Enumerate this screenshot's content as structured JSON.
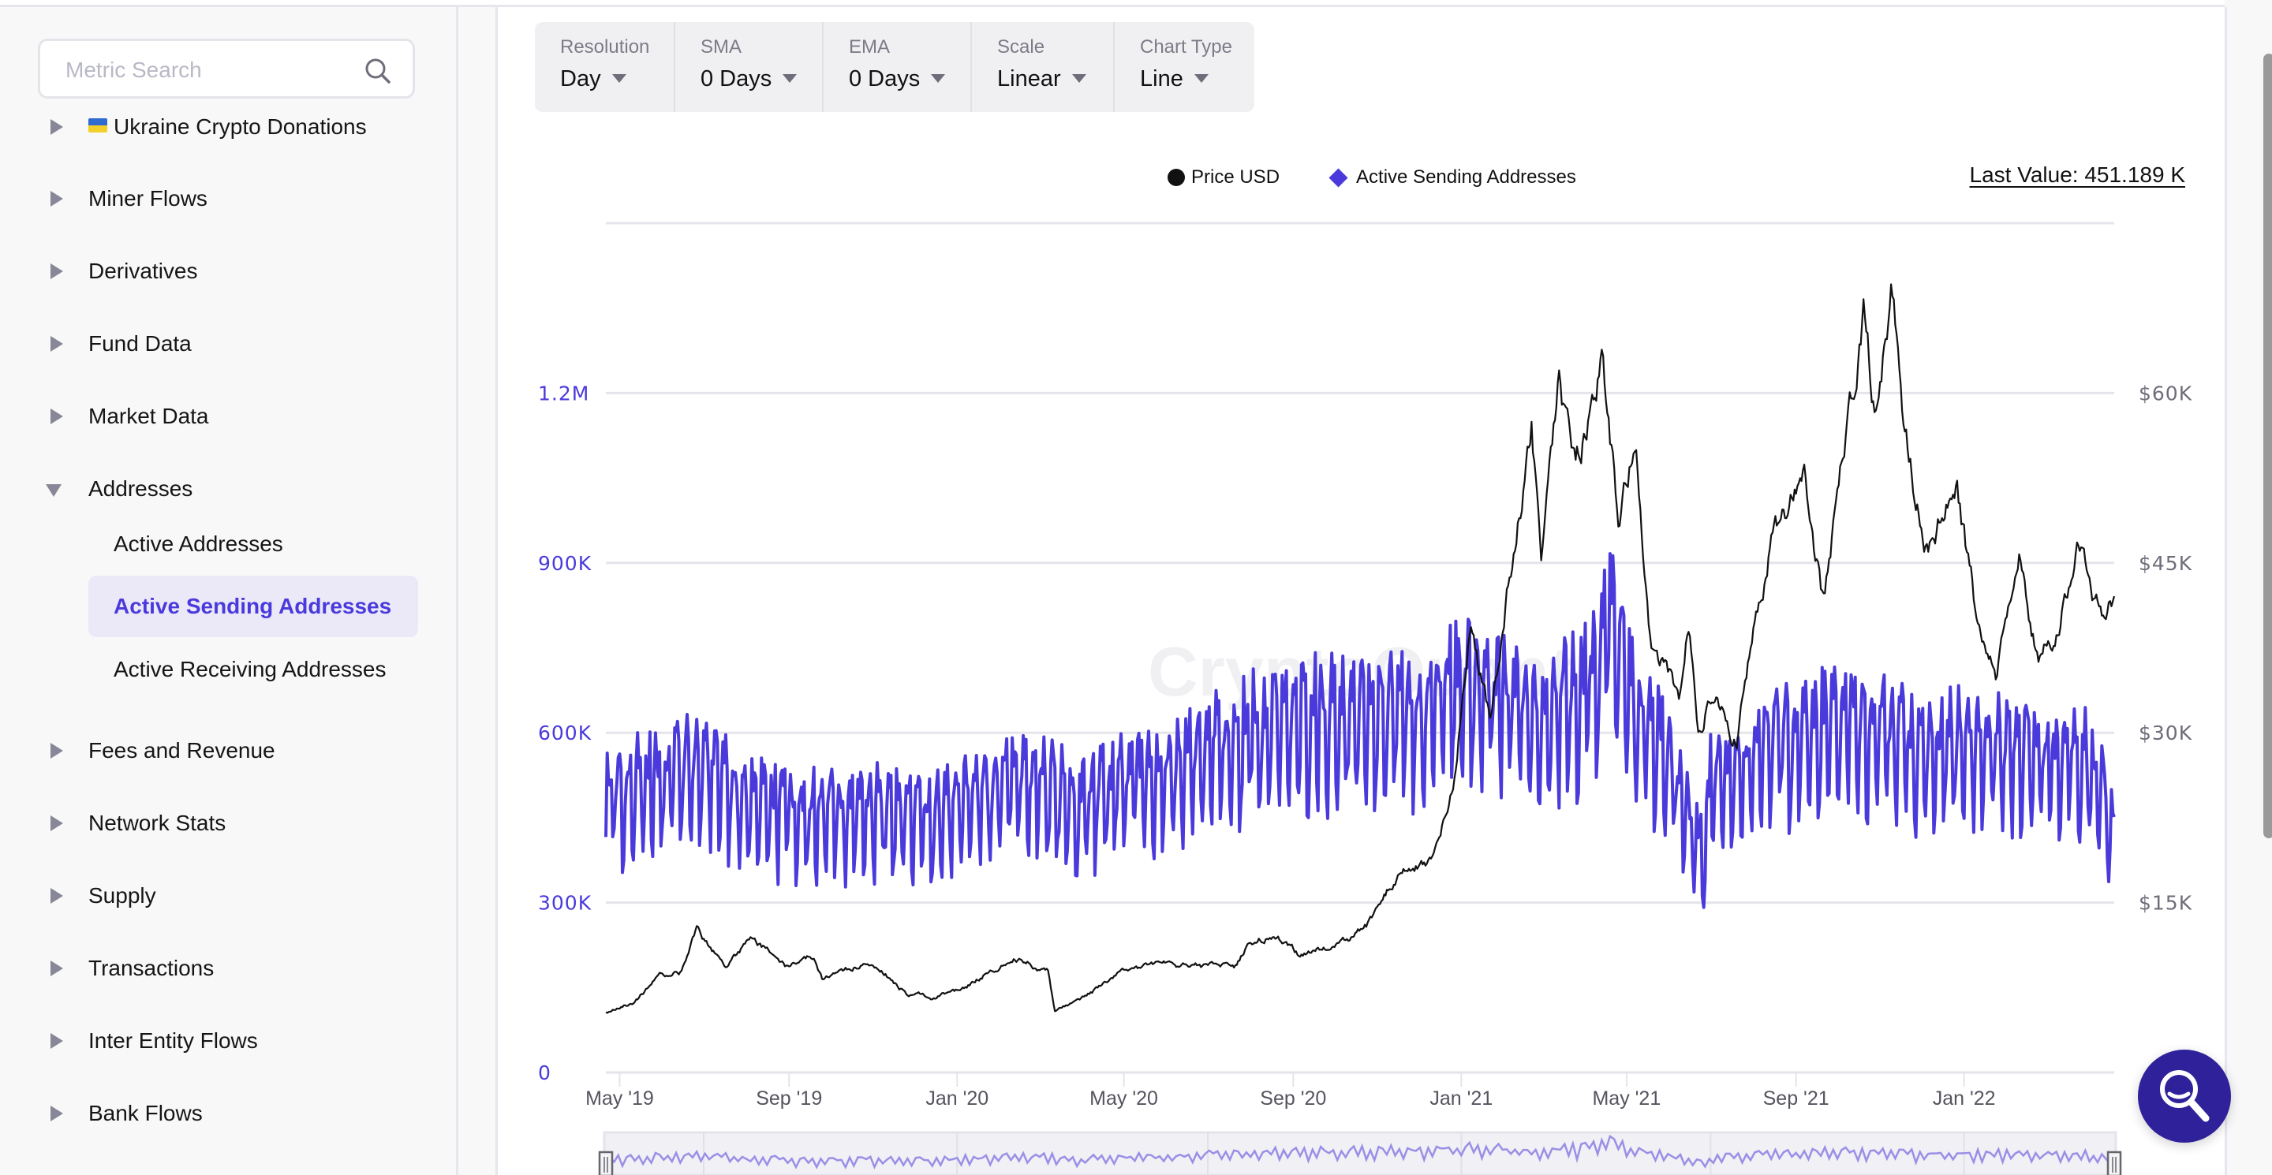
{
  "sidebar": {
    "search": {
      "placeholder": "Metric Search",
      "value": "",
      "icon": "search-icon"
    },
    "items": [
      {
        "label": "Ukraine Crypto Donations",
        "flag": "ukraine-flag",
        "expanded": false
      },
      {
        "label": "Miner Flows",
        "expanded": false
      },
      {
        "label": "Derivatives",
        "expanded": false
      },
      {
        "label": "Fund Data",
        "expanded": false
      },
      {
        "label": "Market Data",
        "expanded": false
      },
      {
        "label": "Addresses",
        "expanded": true,
        "children": [
          {
            "label": "Active Addresses",
            "active": false
          },
          {
            "label": "Active Sending Addresses",
            "active": true
          },
          {
            "label": "Active Receiving Addresses",
            "active": false
          }
        ]
      },
      {
        "label": "Fees and Revenue",
        "expanded": false
      },
      {
        "label": "Network Stats",
        "expanded": false
      },
      {
        "label": "Supply",
        "expanded": false
      },
      {
        "label": "Transactions",
        "expanded": false
      },
      {
        "label": "Inter Entity Flows",
        "expanded": false
      },
      {
        "label": "Bank Flows",
        "expanded": false
      }
    ]
  },
  "toolbar": [
    {
      "label": "Resolution",
      "value": "Day"
    },
    {
      "label": "SMA",
      "value": "0 Days"
    },
    {
      "label": "EMA",
      "value": "0 Days"
    },
    {
      "label": "Scale",
      "value": "Linear"
    },
    {
      "label": "Chart Type",
      "value": "Line"
    }
  ],
  "legend": {
    "price": "Price USD",
    "metric": "Active Sending Addresses"
  },
  "last_value": "Last Value: 451.189 K",
  "watermark": "CryptoQuant",
  "colors": {
    "accent": "#4a3adb",
    "price_line": "#111111",
    "fab": "#2e219a",
    "navigator_line": "#9a8fe6"
  },
  "chart_data": {
    "type": "line",
    "title": "",
    "x_range": [
      "2019-04-21",
      "2022-04-20"
    ],
    "x_ticks": [
      "May '19",
      "Sep '19",
      "Jan '20",
      "May '20",
      "Sep '20",
      "Jan '21",
      "May '21",
      "Sep '21",
      "Jan '22"
    ],
    "x_tick_dates": [
      "2019-05-01",
      "2019-09-01",
      "2020-01-01",
      "2020-05-01",
      "2020-09-01",
      "2021-01-01",
      "2021-05-01",
      "2021-09-01",
      "2022-01-01"
    ],
    "navigator_separators": [
      "2019-07-01",
      "2020-01-01",
      "2020-07-01",
      "2021-01-01",
      "2021-07-01",
      "2022-01-01"
    ],
    "y_left": {
      "label": "Active Sending Addresses",
      "range": [
        0,
        1500000
      ],
      "ticks": [
        0,
        300000,
        600000,
        900000,
        1200000
      ],
      "tick_labels": [
        "0",
        "300K",
        "600K",
        "900K",
        "1.2M"
      ]
    },
    "y_right": {
      "label": "Price USD",
      "range": [
        0,
        75000
      ],
      "ticks": [
        15000,
        30000,
        45000,
        60000
      ],
      "tick_labels": [
        "$15K",
        "$30K",
        "$45K",
        "$60K"
      ]
    },
    "grid": true,
    "legend_position": "top-center",
    "series": [
      {
        "name": "Price USD",
        "axis": "right",
        "points": [
          [
            "2019-04-21",
            5300
          ],
          [
            "2019-05-10",
            6100
          ],
          [
            "2019-05-30",
            8600
          ],
          [
            "2019-06-15",
            8900
          ],
          [
            "2019-06-26",
            12900
          ],
          [
            "2019-07-05",
            11200
          ],
          [
            "2019-07-17",
            9500
          ],
          [
            "2019-08-06",
            11900
          ],
          [
            "2019-08-29",
            9500
          ],
          [
            "2019-09-19",
            10200
          ],
          [
            "2019-09-25",
            8400
          ],
          [
            "2019-10-10",
            8600
          ],
          [
            "2019-10-26",
            9800
          ],
          [
            "2019-11-10",
            8800
          ],
          [
            "2019-11-25",
            7000
          ],
          [
            "2019-12-17",
            6700
          ],
          [
            "2020-01-01",
            7200
          ],
          [
            "2020-01-20",
            8700
          ],
          [
            "2020-02-12",
            10300
          ],
          [
            "2020-03-07",
            9000
          ],
          [
            "2020-03-12",
            5400
          ],
          [
            "2020-04-01",
            6500
          ],
          [
            "2020-04-30",
            8800
          ],
          [
            "2020-05-20",
            9500
          ],
          [
            "2020-06-15",
            9400
          ],
          [
            "2020-07-20",
            9200
          ],
          [
            "2020-08-01",
            11500
          ],
          [
            "2020-08-17",
            12200
          ],
          [
            "2020-09-04",
            10400
          ],
          [
            "2020-10-10",
            11300
          ],
          [
            "2020-10-25",
            13000
          ],
          [
            "2020-11-20",
            18500
          ],
          [
            "2020-12-10",
            18300
          ],
          [
            "2020-12-27",
            26500
          ],
          [
            "2021-01-08",
            40500
          ],
          [
            "2021-01-22",
            30800
          ],
          [
            "2021-02-08",
            46500
          ],
          [
            "2021-02-21",
            57000
          ],
          [
            "2021-02-28",
            45000
          ],
          [
            "2021-03-13",
            61000
          ],
          [
            "2021-03-25",
            52000
          ],
          [
            "2021-04-14",
            63500
          ],
          [
            "2021-04-25",
            49000
          ],
          [
            "2021-05-08",
            58000
          ],
          [
            "2021-05-19",
            37000
          ],
          [
            "2021-06-08",
            33000
          ],
          [
            "2021-06-15",
            40000
          ],
          [
            "2021-06-22",
            30500
          ],
          [
            "2021-07-03",
            34500
          ],
          [
            "2021-07-20",
            29800
          ],
          [
            "2021-08-14",
            47000
          ],
          [
            "2021-09-07",
            52500
          ],
          [
            "2021-09-21",
            41000
          ],
          [
            "2021-10-06",
            55000
          ],
          [
            "2021-10-20",
            66000
          ],
          [
            "2021-10-28",
            58500
          ],
          [
            "2021-11-09",
            68500
          ],
          [
            "2021-11-18",
            57000
          ],
          [
            "2021-12-04",
            47000
          ],
          [
            "2021-12-27",
            51000
          ],
          [
            "2022-01-10",
            40000
          ],
          [
            "2022-01-24",
            35000
          ],
          [
            "2022-02-10",
            44500
          ],
          [
            "2022-02-24",
            37000
          ],
          [
            "2022-03-07",
            38000
          ],
          [
            "2022-03-28",
            47500
          ],
          [
            "2022-04-11",
            40000
          ],
          [
            "2022-04-20",
            41300
          ]
        ]
      },
      {
        "name": "Active Sending Addresses",
        "axis": "left",
        "last_value": 451189,
        "points": [
          [
            "2019-04-21",
            500000
          ],
          [
            "2019-06-01",
            540000
          ],
          [
            "2019-07-01",
            560000
          ],
          [
            "2019-08-01",
            500000
          ],
          [
            "2019-09-01",
            470000
          ],
          [
            "2019-10-01",
            470000
          ],
          [
            "2019-11-01",
            480000
          ],
          [
            "2019-12-01",
            460000
          ],
          [
            "2020-01-01",
            480000
          ],
          [
            "2020-02-01",
            520000
          ],
          [
            "2020-03-01",
            530000
          ],
          [
            "2020-04-01",
            480000
          ],
          [
            "2020-05-01",
            530000
          ],
          [
            "2020-06-01",
            540000
          ],
          [
            "2020-07-01",
            580000
          ],
          [
            "2020-08-01",
            620000
          ],
          [
            "2020-09-01",
            640000
          ],
          [
            "2020-10-01",
            650000
          ],
          [
            "2020-11-01",
            660000
          ],
          [
            "2020-12-01",
            650000
          ],
          [
            "2021-01-01",
            700000
          ],
          [
            "2021-02-01",
            680000
          ],
          [
            "2021-03-01",
            650000
          ],
          [
            "2021-04-01",
            690000
          ],
          [
            "2021-04-20",
            820000
          ],
          [
            "2021-05-01",
            700000
          ],
          [
            "2021-06-01",
            560000
          ],
          [
            "2021-06-27",
            380000
          ],
          [
            "2021-07-01",
            520000
          ],
          [
            "2021-08-01",
            580000
          ],
          [
            "2021-09-01",
            610000
          ],
          [
            "2021-10-01",
            640000
          ],
          [
            "2021-11-01",
            620000
          ],
          [
            "2021-12-01",
            580000
          ],
          [
            "2022-01-01",
            600000
          ],
          [
            "2022-02-01",
            580000
          ],
          [
            "2022-03-01",
            570000
          ],
          [
            "2022-04-01",
            570000
          ],
          [
            "2022-04-20",
            451189
          ]
        ]
      }
    ]
  }
}
